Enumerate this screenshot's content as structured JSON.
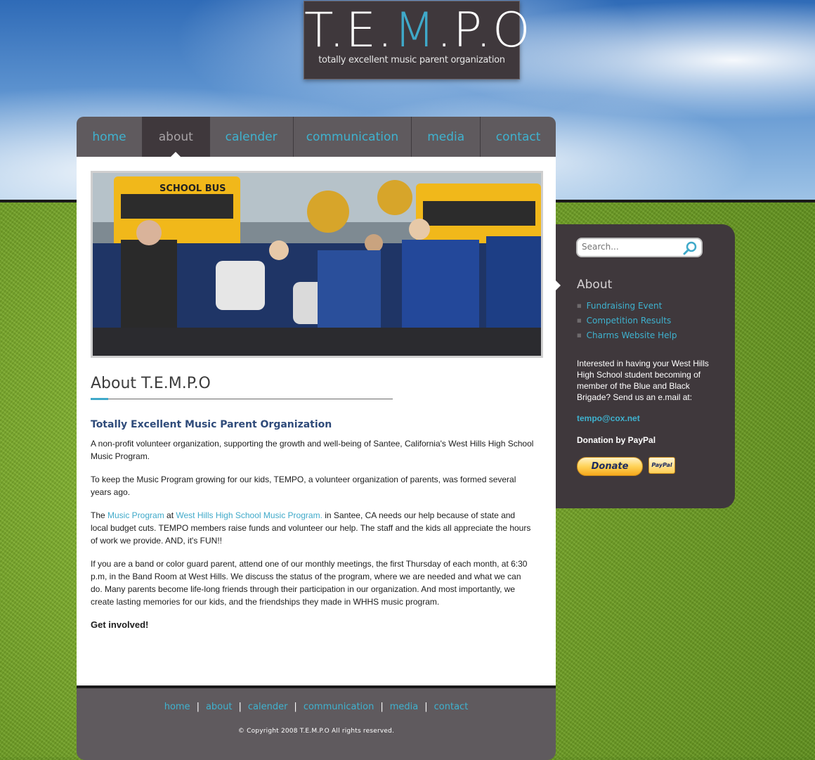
{
  "logo": {
    "title_pre": "T.E.",
    "title_accent": "M",
    "title_post": ".P.O",
    "subtitle": "totally excellent music parent organization"
  },
  "nav": {
    "items": [
      {
        "label": "home",
        "active": false
      },
      {
        "label": "about",
        "active": true
      },
      {
        "label": "calender",
        "active": false
      },
      {
        "label": "communication",
        "active": false
      },
      {
        "label": "media",
        "active": false
      },
      {
        "label": "contact",
        "active": false
      }
    ]
  },
  "main": {
    "page_title": "About T.E.M.P.O",
    "subheading": "Totally Excellent Music Parent Organization",
    "p1": "A non-profit volunteer organization, supporting the growth and well-being of Santee, California's West Hills High School Music Program.",
    "p2": "To keep the Music Program growing for our kids, TEMPO, a volunteer organization of parents, was formed several years ago.",
    "p3_pre": "The ",
    "p3_link1": "Music Program",
    "p3_mid": " at ",
    "p3_link2": "West Hills High School Music Program.",
    "p3_post": " in Santee, CA needs our help because of state and local budget cuts. TEMPO members raise funds and volunteer our help. The staff and the kids all appreciate the hours of work we provide. AND, it's FUN!!",
    "p4": "If you are a band or color guard parent, attend one of our monthly meetings, the first Thursday of each month, at 6:30 p.m, in the Band Room at West Hills. We discuss the status of the program, where we are needed and what we can do. Many parents become life-long friends through their participation in our organization. And most importantly, we create lasting memories for our kids, and the friendships they made in WHHS music program.",
    "cta": "Get involved!",
    "hero_bus_label": "SCHOOL BUS"
  },
  "sidebar": {
    "search_placeholder": "Search...",
    "heading": "About",
    "links": [
      "Fundraising Event",
      "Competition Results",
      "Charms Website Help"
    ],
    "text": "Interested in having your West Hills High School student becoming of member of the Blue and Black Brigade? Send us an e.mail at:",
    "email": "tempo@cox.net",
    "donation_label": "Donation by PayPal",
    "donate_button": "Donate",
    "paypal_badge": "PayPal"
  },
  "footer": {
    "links": [
      "home",
      "about",
      "calender",
      "communication",
      "media",
      "contact"
    ],
    "copyright": "© Copyright 2008 T.E.M.P.O All rights reserved."
  },
  "colors": {
    "accent": "#3fa9c9",
    "nav_bg": "#5f5a5e",
    "panel_dark": "#3f383c",
    "heading_blue": "#2f4b7a"
  }
}
